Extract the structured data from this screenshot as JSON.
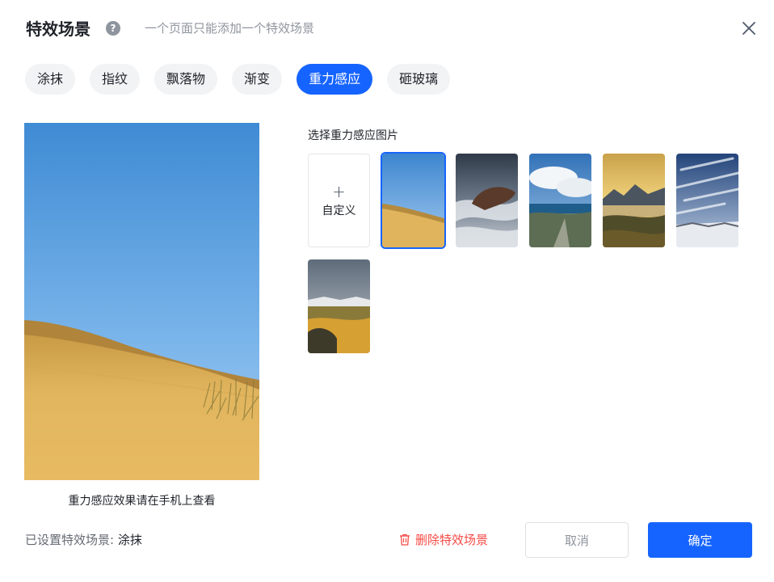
{
  "dialog": {
    "title": "特效场景",
    "help_icon": "question-circle-icon",
    "subtitle": "一个页面只能添加一个特效场景",
    "close_icon": "close-icon"
  },
  "tabs": [
    {
      "label": "涂抹",
      "active": false
    },
    {
      "label": "指纹",
      "active": false
    },
    {
      "label": "飘落物",
      "active": false
    },
    {
      "label": "渐变",
      "active": false
    },
    {
      "label": "重力感应",
      "active": true
    },
    {
      "label": "砸玻璃",
      "active": false
    }
  ],
  "preview": {
    "caption": "重力感应效果请在手机上查看"
  },
  "gallery": {
    "label": "选择重力感应图片",
    "custom_tile": {
      "icon": "plus-icon",
      "label": "自定义"
    },
    "images": [
      {
        "name": "desert-dunes",
        "selected": true
      },
      {
        "name": "misty-rock",
        "selected": false
      },
      {
        "name": "coastal-clouds",
        "selected": false
      },
      {
        "name": "golden-mountain-lake",
        "selected": false
      },
      {
        "name": "snowy-sky-streaks",
        "selected": false
      },
      {
        "name": "autumn-plateau",
        "selected": false
      }
    ]
  },
  "footer": {
    "status_label": "已设置特效场景:",
    "status_value": "涂抹",
    "delete_label": "删除特效场景",
    "delete_icon": "trash-icon",
    "cancel_label": "取消",
    "ok_label": "确定"
  },
  "colors": {
    "accent": "#1664ff",
    "danger": "#f54a45",
    "tab_bg": "#f2f3f5"
  }
}
